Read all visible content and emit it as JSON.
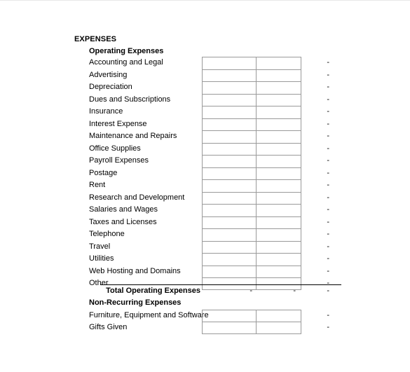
{
  "document": {
    "section_title": "EXPENSES"
  },
  "operating": {
    "heading": "Operating Expenses",
    "items": [
      {
        "label": "Accounting and Legal",
        "value": "-"
      },
      {
        "label": "Advertising",
        "value": "-"
      },
      {
        "label": "Depreciation",
        "value": "-"
      },
      {
        "label": "Dues and Subscriptions",
        "value": "-"
      },
      {
        "label": "Insurance",
        "value": "-"
      },
      {
        "label": "Interest Expense",
        "value": "-"
      },
      {
        "label": "Maintenance and Repairs",
        "value": "-"
      },
      {
        "label": "Office Supplies",
        "value": "-"
      },
      {
        "label": "Payroll Expenses",
        "value": "-"
      },
      {
        "label": "Postage",
        "value": "-"
      },
      {
        "label": "Rent",
        "value": "-"
      },
      {
        "label": "Research and Development",
        "value": "-"
      },
      {
        "label": "Salaries and Wages",
        "value": "-"
      },
      {
        "label": "Taxes and Licenses",
        "value": "-"
      },
      {
        "label": "Telephone",
        "value": "-"
      },
      {
        "label": "Travel",
        "value": "-"
      },
      {
        "label": "Utilities",
        "value": "-"
      },
      {
        "label": "Web Hosting and Domains",
        "value": "-"
      },
      {
        "label": "Other",
        "value": "-"
      }
    ],
    "total": {
      "label": "Total Operating Expenses",
      "value_1": "-",
      "value_2": "-",
      "value_3": "-"
    }
  },
  "non_recurring": {
    "heading": "Non-Recurring Expenses",
    "items": [
      {
        "label": "Furniture, Equipment and Software",
        "value": "-"
      },
      {
        "label": "Gifts Given",
        "value": "-"
      }
    ]
  },
  "input_cells": {
    "column_1_value": "",
    "column_2_value": "",
    "placeholder": ""
  },
  "colors": {
    "text": "#000000",
    "cell_border": "#9a9a9a",
    "total_rule": "#000000",
    "background": "#ffffff"
  }
}
